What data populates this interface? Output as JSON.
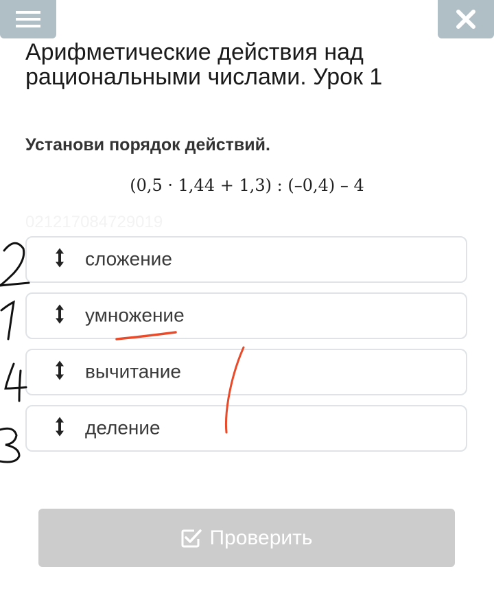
{
  "header": {
    "menu_icon": "hamburger-menu-icon",
    "close_icon": "close-icon",
    "button_color": "#b0bec5"
  },
  "lesson": {
    "title": "Арифметические действия над рациональными числами. Урок 1"
  },
  "task": {
    "instruction": "Установи порядок действий.",
    "expression": "(0,5 · 1,44 + 1,3) : (–0,4) – 4",
    "watermark": "021217084729019"
  },
  "options": [
    {
      "label": "сложение",
      "icon": "drag-arrows-icon"
    },
    {
      "label": "умножение",
      "icon": "drag-arrows-icon"
    },
    {
      "label": "вычитание",
      "icon": "drag-arrows-icon"
    },
    {
      "label": "деление",
      "icon": "drag-arrows-icon"
    }
  ],
  "check_button": {
    "label": "Проверить",
    "icon": "checkbox-check-icon",
    "color": "#cccccc"
  },
  "handwriting": {
    "numbers": [
      "2",
      "1",
      "4",
      "3"
    ],
    "ink_color_numbers": "#111111",
    "ink_color_marks": "#e84a2a"
  }
}
